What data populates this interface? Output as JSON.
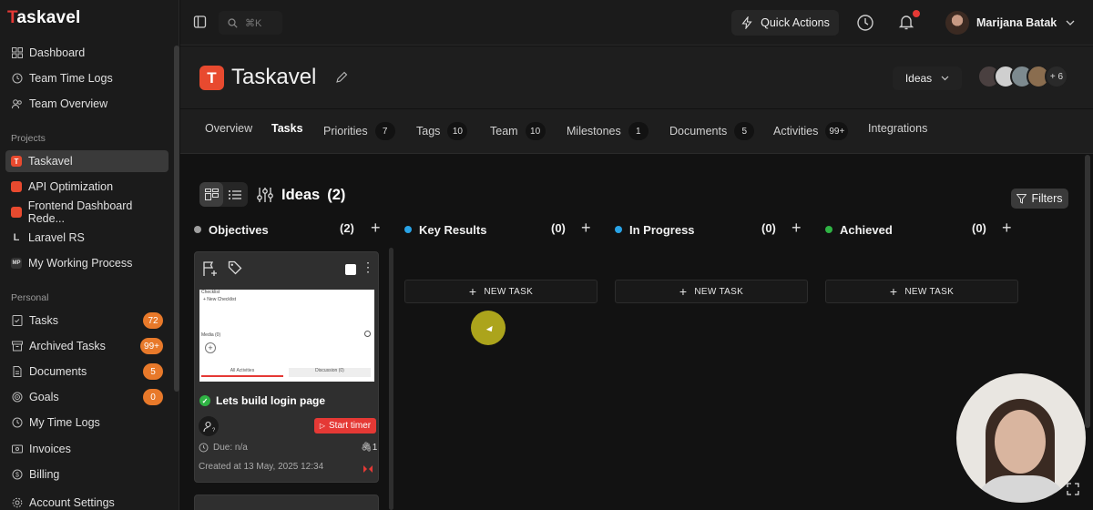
{
  "app": {
    "logo_prefix": "T",
    "logo_rest": "askavel"
  },
  "sidebar": {
    "main_items": [
      {
        "label": "Dashboard",
        "icon": "grid-icon"
      },
      {
        "label": "Team Time Logs",
        "icon": "clock-icon"
      },
      {
        "label": "Team Overview",
        "icon": "users-icon"
      }
    ],
    "projects_label": "Projects",
    "projects": [
      {
        "label": "Taskavel",
        "icon_text": "T",
        "active": true
      },
      {
        "label": "API Optimization",
        "icon_text": ""
      },
      {
        "label": "Frontend Dashboard Rede...",
        "icon_text": ""
      },
      {
        "label": "Laravel RS",
        "icon_text": "L"
      },
      {
        "label": "My Working Process",
        "icon_text": "MP"
      }
    ],
    "personal_label": "Personal",
    "personal": [
      {
        "label": "Tasks",
        "icon": "checklist-icon",
        "badge": "72"
      },
      {
        "label": "Archived Tasks",
        "icon": "archive-icon",
        "badge": "99+"
      },
      {
        "label": "Documents",
        "icon": "document-icon",
        "badge": "5"
      },
      {
        "label": "Goals",
        "icon": "target-icon",
        "badge": "0"
      },
      {
        "label": "My Time Logs",
        "icon": "clock-icon"
      },
      {
        "label": "Invoices",
        "icon": "invoice-icon"
      },
      {
        "label": "Billing",
        "icon": "dollar-icon"
      },
      {
        "label": "Account Settings",
        "icon": "gear-icon"
      }
    ]
  },
  "topbar": {
    "search_shortcut": "⌘K",
    "quick_actions": "Quick Actions",
    "user_name": "Marijana Batak"
  },
  "project": {
    "logo_letter": "T",
    "title": "Taskavel",
    "view_select": "Ideas",
    "members_more": "+ 6"
  },
  "tabs": [
    {
      "label": "Overview"
    },
    {
      "label": "Tasks",
      "active": true
    },
    {
      "label": "Priorities",
      "count": "7"
    },
    {
      "label": "Tags",
      "count": "10"
    },
    {
      "label": "Team",
      "count": "10"
    },
    {
      "label": "Milestones",
      "count": "1"
    },
    {
      "label": "Documents",
      "count": "5"
    },
    {
      "label": "Activities",
      "count": "99+"
    },
    {
      "label": "Integrations"
    }
  ],
  "board": {
    "title": "Ideas",
    "count": "(2)",
    "filters": "Filters",
    "columns": [
      {
        "name": "Objectives",
        "count": "(2)",
        "color": "#9e9e9e"
      },
      {
        "name": "Key Results",
        "count": "(0)",
        "color": "#29a3e6",
        "new_task": "NEW TASK"
      },
      {
        "name": "In Progress",
        "count": "(0)",
        "color": "#29a3e6",
        "new_task": "NEW TASK"
      },
      {
        "name": "Achieved",
        "count": "(0)",
        "color": "#2fb344",
        "new_task": "NEW TASK"
      }
    ]
  },
  "card": {
    "thumb": {
      "line1": "Checklist",
      "line2": "+ New Checklist",
      "line3": "Media (0)",
      "tab1": "All Activities",
      "tab2": "Discussion (0)"
    },
    "title": "Lets build login page",
    "start_timer": "Start timer",
    "due": "Due: n/a",
    "attachments": "1",
    "created": "Created at 13 May, 2025 12:34"
  },
  "colors": {
    "accent": "#e53935",
    "badge": "#e8792a",
    "success": "#2fb344",
    "info": "#29a3e6"
  }
}
